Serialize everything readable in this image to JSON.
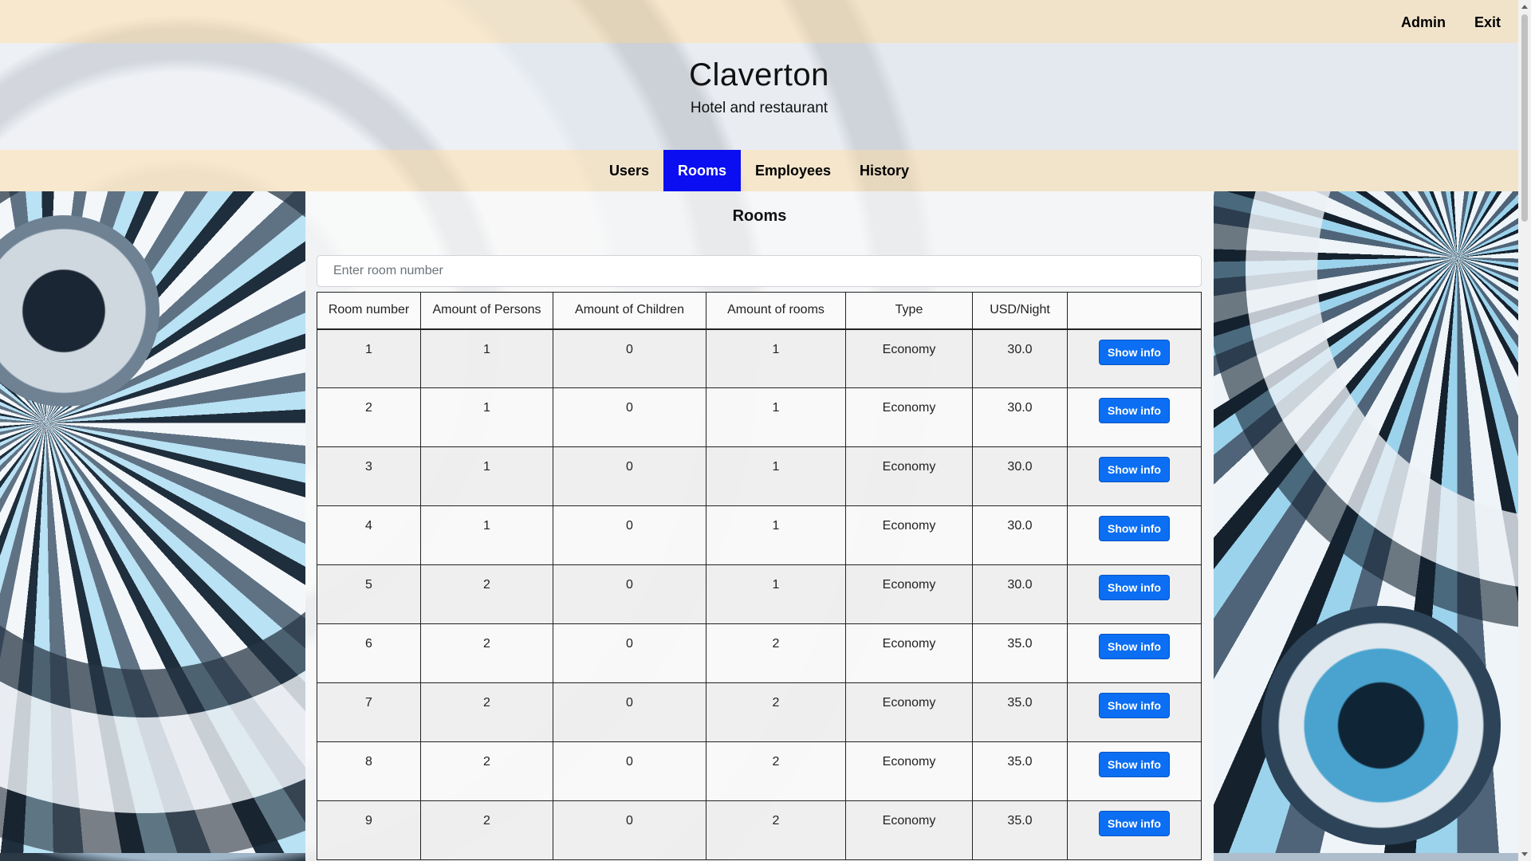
{
  "header": {
    "links": [
      "Admin",
      "Exit"
    ],
    "title": "Claverton",
    "subtitle": "Hotel and restaurant"
  },
  "nav": {
    "items": [
      {
        "label": "Users",
        "active": false
      },
      {
        "label": "Rooms",
        "active": true
      },
      {
        "label": "Employees",
        "active": false
      },
      {
        "label": "History",
        "active": false
      }
    ]
  },
  "page": {
    "title": "Rooms",
    "search_placeholder": "Enter room number"
  },
  "table": {
    "columns": [
      "Room number",
      "Amount of Persons",
      "Amount of Children",
      "Amount of rooms",
      "Type",
      "USD/Night",
      ""
    ],
    "button_label": "Show info",
    "rows": [
      [
        "1",
        "1",
        "0",
        "1",
        "Economy",
        "30.0"
      ],
      [
        "2",
        "1",
        "0",
        "1",
        "Economy",
        "30.0"
      ],
      [
        "3",
        "1",
        "0",
        "1",
        "Economy",
        "30.0"
      ],
      [
        "4",
        "1",
        "0",
        "1",
        "Economy",
        "30.0"
      ],
      [
        "5",
        "2",
        "0",
        "1",
        "Economy",
        "30.0"
      ],
      [
        "6",
        "2",
        "0",
        "2",
        "Economy",
        "35.0"
      ],
      [
        "7",
        "2",
        "0",
        "2",
        "Economy",
        "35.0"
      ],
      [
        "8",
        "2",
        "0",
        "2",
        "Economy",
        "35.0"
      ],
      [
        "9",
        "2",
        "0",
        "2",
        "Economy",
        "35.0"
      ]
    ]
  },
  "colors": {
    "nav_active": "#0a0ef0",
    "button": "#0b6ef3",
    "header_band": "#fae8ca"
  }
}
